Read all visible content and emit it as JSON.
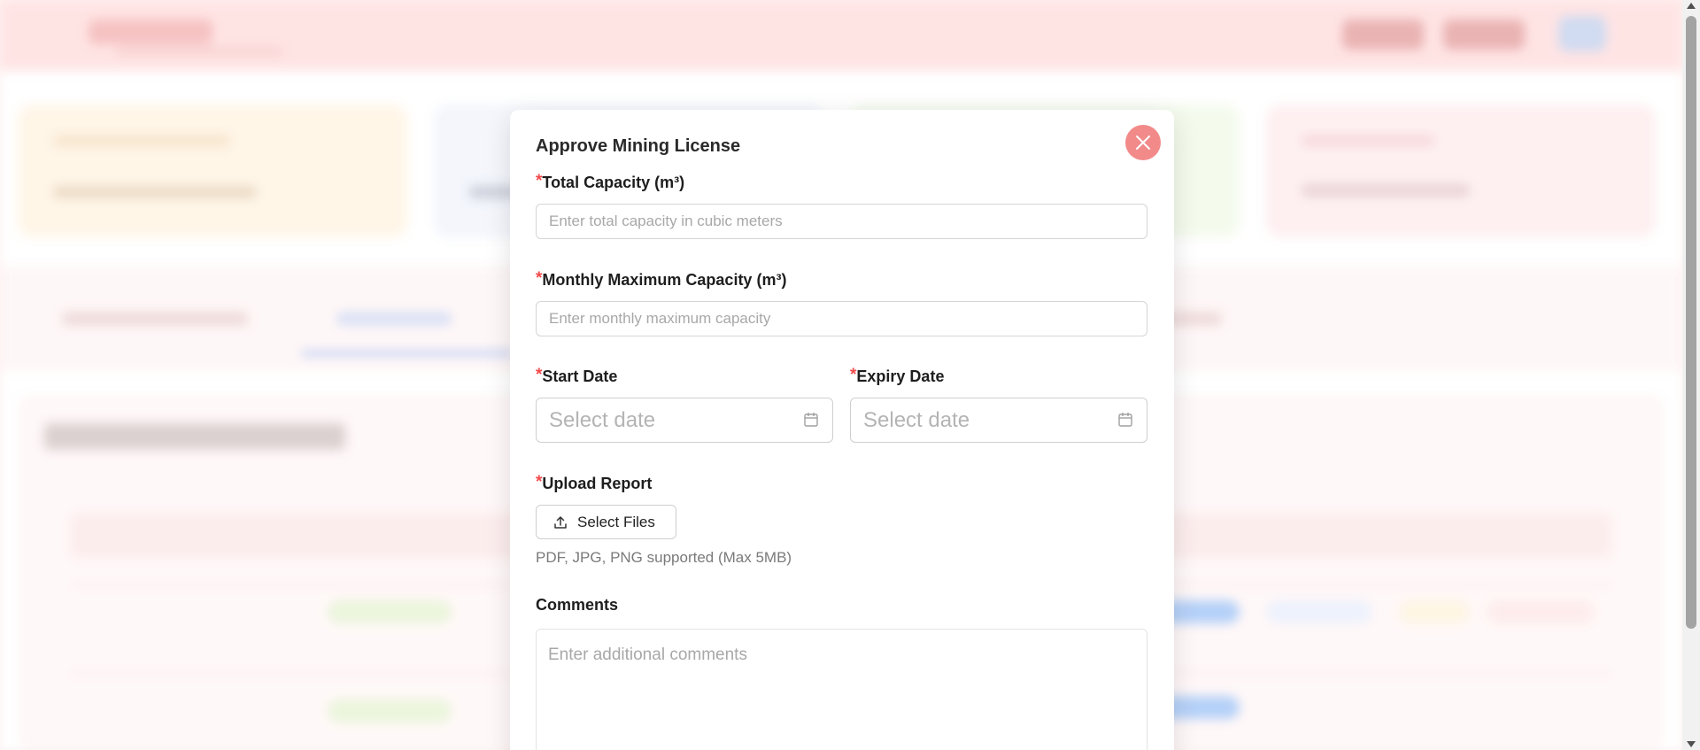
{
  "modal": {
    "title": "Approve Mining License",
    "required_mark": "*",
    "total_capacity": {
      "label": "Total Capacity (m³)",
      "placeholder": "Enter total capacity in cubic meters",
      "value": ""
    },
    "monthly_capacity": {
      "label": "Monthly Maximum Capacity (m³)",
      "placeholder": "Enter monthly maximum capacity",
      "value": ""
    },
    "start_date": {
      "label": "Start Date",
      "placeholder": "Select date"
    },
    "expiry_date": {
      "label": "Expiry Date",
      "placeholder": "Select date"
    },
    "upload": {
      "label": "Upload Report",
      "button_label": "Select Files",
      "hint": "PDF, JPG, PNG supported (Max 5MB)"
    },
    "comments": {
      "label": "Comments",
      "placeholder": "Enter additional comments"
    }
  },
  "icons": {
    "close": "close-icon",
    "calendar": "calendar-icon",
    "upload": "upload-icon"
  },
  "colors": {
    "close_button": "#f28a8a",
    "required_asterisk": "#f24a4a",
    "header_background": "#ffd6d6"
  }
}
